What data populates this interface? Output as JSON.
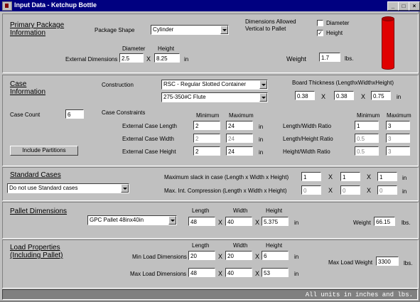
{
  "window": {
    "title": "Input Data -  Ketchup Bottle",
    "min": "_",
    "max": "□",
    "close": "×"
  },
  "primary": {
    "title_line1": "Primary Package",
    "title_line2": "Information",
    "shape_label": "Package Shape",
    "shape_value": "Cylinder",
    "dims_allowed_line1": "Dimensions Allowed",
    "dims_allowed_line2": "Vertical to Pallet",
    "diameter_chk_label": "Diameter",
    "diameter_checked": "",
    "height_chk_label": "Height",
    "height_checked": "✓",
    "col_diameter": "Diameter",
    "col_height": "Height",
    "ext_dims_label": "External Dimensions",
    "diameter_value": "2.5",
    "x": "X",
    "height_value": "8.25",
    "unit_in": "in",
    "weight_label": "Weight",
    "weight_value": "1.7",
    "weight_unit": "lbs."
  },
  "case": {
    "title_line1": "Case",
    "title_line2": "Information",
    "construction_label": "Construction",
    "construction_value": "RSC - Regular Slotted Container",
    "flute_value": "275-350#C Flute",
    "board_label": "Board Thickness (LengthxWidthxHeight)",
    "board_l": "0.38",
    "board_w": "0.38",
    "board_h": "0.75",
    "x": "X",
    "unit_in": "in",
    "count_label": "Case Count",
    "count_value": "6",
    "constraints_label": "Case Constraints",
    "col_min": "Minimum",
    "col_max": "Maximum",
    "len_label": "External Case Length",
    "len_min": "2",
    "len_max": "24",
    "wid_label": "External Case Width",
    "wid_min": "2",
    "wid_max": "24",
    "hgt_label": "External Case Height",
    "hgt_min": "2",
    "hgt_max": "24",
    "ratio_col_min": "Minimum",
    "ratio_col_max": "Maximum",
    "lw_label": "Length/Width Ratio",
    "lw_min": "1",
    "lw_max": "3",
    "lh_label": "Length/Height Ratio",
    "lh_min": "0.5",
    "lh_max": "3",
    "hw_label": "Height/Width Ratio",
    "hw_min": "0.5",
    "hw_max": "3",
    "partitions_button": "Include Partitions"
  },
  "standard": {
    "title": "Standard Cases",
    "select_value": "Do not use Standard cases",
    "slack_label": "Maximum slack in case  (Length x Width x Height)",
    "slack_l": "1",
    "slack_w": "1",
    "slack_h": "1",
    "comp_label": "Max. Int. Compression (Length x Width x Height)",
    "comp_l": "0",
    "comp_w": "0",
    "comp_h": "0",
    "x": "X",
    "unit_in": "in"
  },
  "pallet": {
    "title": "Pallet Dimensions",
    "select_value": "GPC Pallet 48inx40in",
    "col_length": "Length",
    "col_width": "Width",
    "col_height": "Height",
    "length": "48",
    "width": "40",
    "height": "5.375",
    "x": "X",
    "unit_in": "in",
    "weight_label": "Weight",
    "weight_value": "66.15",
    "weight_unit": "lbs."
  },
  "load": {
    "title_line1": "Load Properties",
    "title_line2": "(Including Pallet)",
    "col_length": "Length",
    "col_width": "Width",
    "col_height": "Height",
    "min_label": "Min Load Dimensions",
    "min_l": "20",
    "min_w": "20",
    "min_h": "6",
    "max_label": "Max Load Dimensions",
    "max_l": "48",
    "max_w": "40",
    "max_h": "53",
    "x": "X",
    "unit_in": "in",
    "weight_label": "Max Load Weight",
    "weight_value": "3300",
    "weight_unit": "lbs."
  },
  "status": {
    "text": "All units in inches and lbs."
  },
  "colors": {
    "titlebar": "#000080",
    "bottle": "#e00000",
    "face": "#c0c0c0",
    "status": "#808080"
  }
}
